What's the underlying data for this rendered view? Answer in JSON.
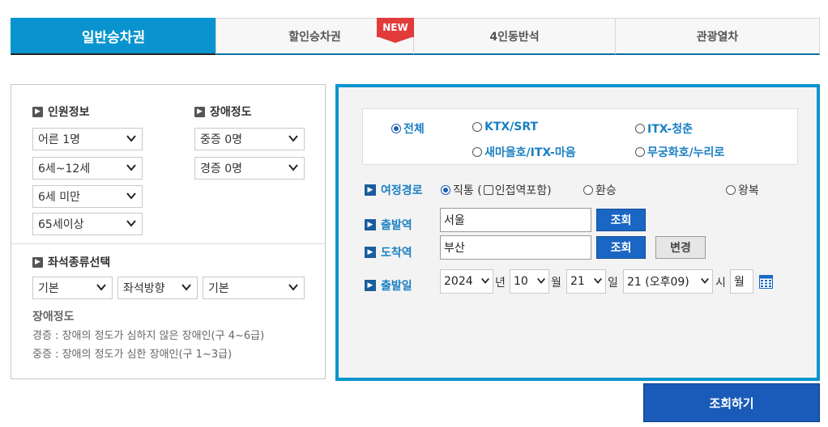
{
  "tabs": [
    {
      "label": "일반승차권"
    },
    {
      "label": "할인승차권"
    },
    {
      "label": "4인동반석"
    },
    {
      "label": "관광열차"
    }
  ],
  "new_badge": "NEW",
  "passenger": {
    "title": "인원정보",
    "adult": "어른 1명",
    "child": "6세~12세",
    "toddler": "6세 미만",
    "senior": "65세이상"
  },
  "disability": {
    "title": "장애정도",
    "severe": "중증 0명",
    "mild": "경증 0명"
  },
  "seat": {
    "title": "좌석종류선택",
    "type": "기본",
    "direction": "좌석방향",
    "position": "기본"
  },
  "notes": {
    "title": "장애정도",
    "mild": "경증 : 장애의 정도가 심하지 않은 장애인(구 4~6급)",
    "severe": "중증 : 장애의 정도가 심한 장애인(구 1~3급)"
  },
  "train_types": {
    "all": "전체",
    "ktx": "KTX/SRT",
    "itx_cheongchun": "ITX-청춘",
    "saemaeul": "새마을호/ITX-마음",
    "mugunghwa": "무궁화호/누리로"
  },
  "route": {
    "label": "여정경로",
    "direct": "직통 (",
    "transfer_incl": "인접역포함)",
    "transfer": "환승",
    "round": "왕복"
  },
  "departure": {
    "label": "출발역",
    "value": "서울",
    "button": "조회"
  },
  "arrival": {
    "label": "도착역",
    "value": "부산",
    "button": "조회",
    "swap": "변경"
  },
  "date": {
    "label": "출발일",
    "year": "2024",
    "year_unit": "년",
    "month": "10",
    "month_unit": "월",
    "day": "21",
    "day_unit": "일",
    "hour": "21 (오후09)",
    "hour_unit": "시",
    "weekday": "월"
  },
  "search_button": "조회하기"
}
